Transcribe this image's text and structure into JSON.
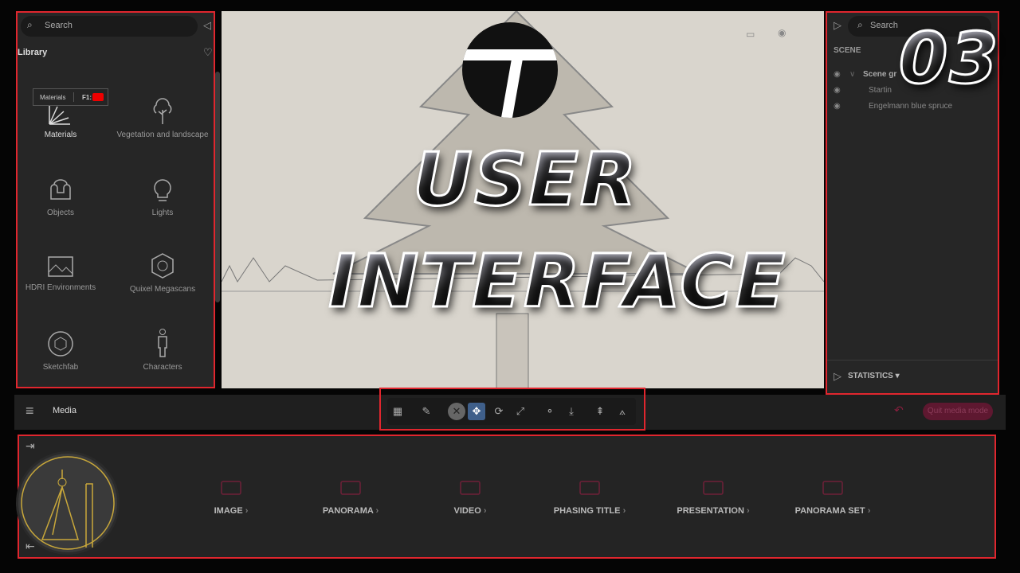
{
  "library": {
    "search_placeholder": "Search",
    "title": "Library",
    "tooltip": {
      "label": "Materials",
      "shortcut": "F1:"
    },
    "items": [
      {
        "label": "Materials",
        "icon": "swatch-fan-icon"
      },
      {
        "label": "Vegetation and landscape",
        "icon": "tree-icon"
      },
      {
        "label": "Objects",
        "icon": "sofa-icon"
      },
      {
        "label": "Lights",
        "icon": "bulb-icon"
      },
      {
        "label": "HDRI Environments",
        "icon": "hdri-image-icon"
      },
      {
        "label": "Quixel Megascans",
        "icon": "quixel-icon"
      },
      {
        "label": "Sketchfab",
        "icon": "sketchfab-icon"
      },
      {
        "label": "Characters",
        "icon": "person-icon"
      }
    ]
  },
  "scene": {
    "search_placeholder": "Search",
    "title": "SCENE",
    "tree": [
      {
        "label": "Scene gr"
      },
      {
        "label": "Startin"
      },
      {
        "label": "Engelmann blue spruce"
      }
    ],
    "statistics": "STATISTICS"
  },
  "toolbar": {
    "mode": "Media",
    "quit": "Quit media mode"
  },
  "media": {
    "items": [
      {
        "label": "IMAGE",
        "icon": "camera-icon"
      },
      {
        "label": "PANORAMA",
        "icon": "panorama-icon"
      },
      {
        "label": "VIDEO",
        "icon": "video-icon"
      },
      {
        "label": "PHASING TITLE",
        "icon": "phasing-icon"
      },
      {
        "label": "PRESENTATION",
        "icon": "walking-person-icon"
      },
      {
        "label": "PANORAMA SET",
        "icon": "panorama-set-icon"
      }
    ]
  },
  "overlay": {
    "line1": "USER",
    "line2": "INTERFACE",
    "episode": "03"
  },
  "colors": {
    "highlight": "#e0262e",
    "accent": "#8a1f3e",
    "active_tool": "#3f5f8a"
  }
}
